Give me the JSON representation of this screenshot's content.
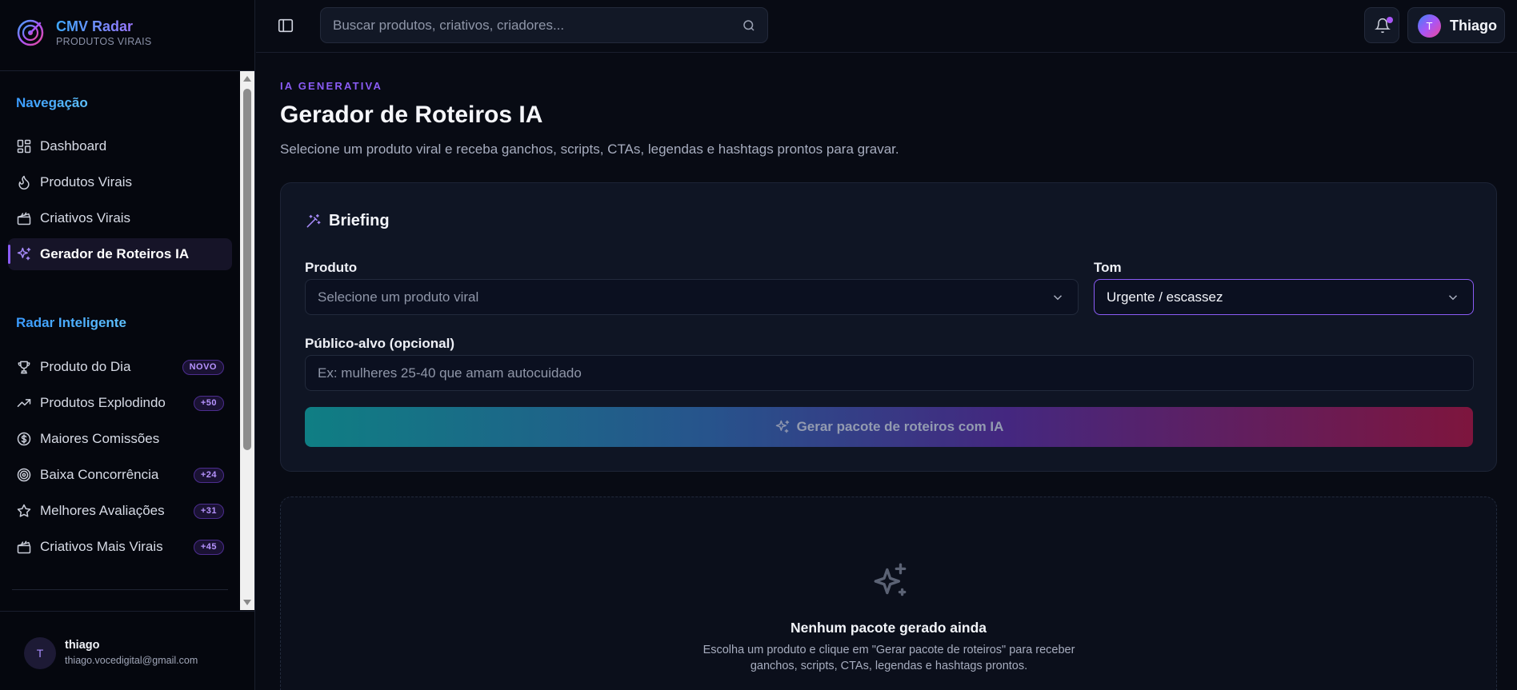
{
  "brand": {
    "title": "CMV Radar",
    "subtitle": "PRODUTOS VIRAIS"
  },
  "sidebar": {
    "sections": [
      {
        "title": "Navegação",
        "items": [
          {
            "label": "Dashboard",
            "icon": "dashboard-icon"
          },
          {
            "label": "Produtos Virais",
            "icon": "flame-icon"
          },
          {
            "label": "Criativos Virais",
            "icon": "clapperboard-icon"
          },
          {
            "label": "Gerador de Roteiros IA",
            "icon": "sparkles-icon",
            "active": true
          }
        ]
      },
      {
        "title": "Radar Inteligente",
        "items": [
          {
            "label": "Produto do Dia",
            "icon": "trophy-icon",
            "badge": "NOVO"
          },
          {
            "label": "Produtos Explodindo",
            "icon": "trending-up-icon",
            "badge": "+50"
          },
          {
            "label": "Maiores Comissões",
            "icon": "dollar-circle-icon"
          },
          {
            "label": "Baixa Concorrência",
            "icon": "target-icon",
            "badge": "+24"
          },
          {
            "label": "Melhores Avaliações",
            "icon": "star-icon",
            "badge": "+31"
          },
          {
            "label": "Criativos Mais Virais",
            "icon": "clapperboard-icon",
            "badge": "+45"
          }
        ]
      }
    ],
    "user": {
      "initial": "T",
      "name": "thiago",
      "email": "thiago.vocedigital@gmail.com"
    }
  },
  "topbar": {
    "search_placeholder": "Buscar produtos, criativos, criadores...",
    "profile_initial": "T",
    "profile_name": "Thiago"
  },
  "main": {
    "eyebrow": "IA GENERATIVA",
    "title": "Gerador de Roteiros IA",
    "subtitle": "Selecione um produto viral e receba ganchos, scripts, CTAs, legendas e hashtags prontos para gravar.",
    "briefing": {
      "title": "Briefing",
      "product_label": "Produto",
      "product_placeholder": "Selecione um produto viral",
      "tone_label": "Tom",
      "tone_value": "Urgente / escassez",
      "audience_label": "Público-alvo (opcional)",
      "audience_placeholder": "Ex: mulheres 25-40 que amam autocuidado",
      "generate_label": "Gerar pacote de roteiros com IA"
    },
    "empty_state": {
      "title": "Nenhum pacote gerado ainda",
      "text": "Escolha um produto e clique em \"Gerar pacote de roteiros\" para receber ganchos, scripts, CTAs, legendas e hashtags prontos."
    }
  },
  "colors": {
    "accent": "#8b5cf6",
    "section_title": "#3ea8ff",
    "background": "#080b14"
  }
}
